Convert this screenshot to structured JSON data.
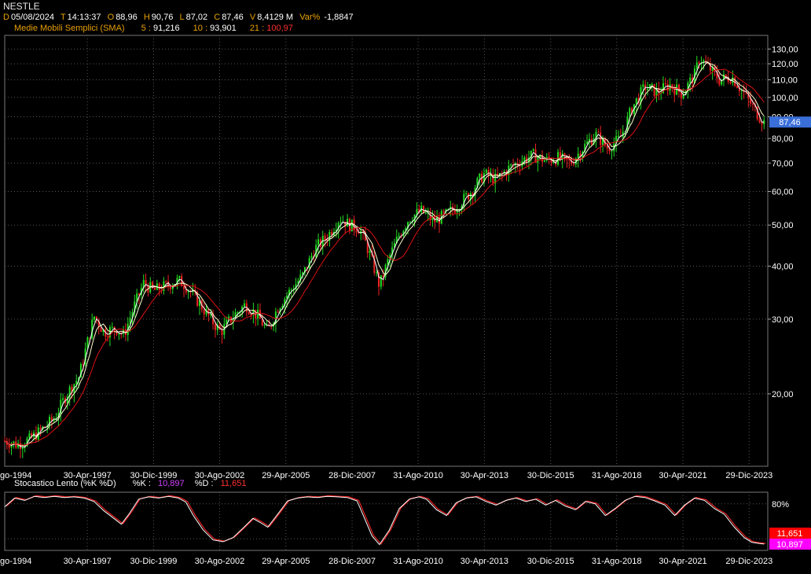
{
  "header": {
    "symbol": "NESTLE",
    "date_label": "D",
    "date": "05/08/2024",
    "time_label": "T",
    "time": "14:13:37",
    "open_label": "O",
    "open": "88,96",
    "high_label": "H",
    "high": "90,76",
    "low_label": "L",
    "low": "87,02",
    "close_label": "C",
    "close": "87,46",
    "volume_label": "V",
    "volume": "8,4129 M",
    "var_label": "Var%",
    "var": "-1,8847"
  },
  "sma": {
    "label": "Medie Mobili Semplici (SMA)",
    "p5_label": "5 :",
    "p5": "91,216",
    "p10_label": "10 :",
    "p10": "93,901",
    "p21_label": "21 :",
    "p21": "100,97"
  },
  "stochastic": {
    "label": "Stocastico Lento (%K %D)",
    "k_label": "%K :",
    "k": "10,897",
    "d_label": "%D :",
    "d": "11,651",
    "level_label": "80%"
  },
  "colors": {
    "background": "#000000",
    "up_candle": "#22dd22",
    "down_candle": "#ee2222",
    "sma5": "#ffffff",
    "sma10": "#ffffcc",
    "sma21": "#dd1111",
    "last_price_tag": "#3a6ed8",
    "d_tag": "#ff0000",
    "k_tag": "#ff00ff",
    "grid": "#555555"
  },
  "chart_data": [
    {
      "type": "candlestick",
      "title": "NESTLE",
      "scale": "log",
      "ylim": [
        13.5,
        140
      ],
      "y_ticks": [
        {
          "value": 130,
          "label": "130,00"
        },
        {
          "value": 120,
          "label": "120,00"
        },
        {
          "value": 110,
          "label": "110,00"
        },
        {
          "value": 100,
          "label": "100,00"
        },
        {
          "value": 90,
          "label": "90,00"
        },
        {
          "value": 80,
          "label": "80,00"
        },
        {
          "value": 70,
          "label": "70,00"
        },
        {
          "value": 60,
          "label": "60,00"
        },
        {
          "value": 50,
          "label": "50,00"
        },
        {
          "value": 40,
          "label": "40,00"
        },
        {
          "value": 30,
          "label": "30,00"
        },
        {
          "value": 20,
          "label": "20,00"
        }
      ],
      "x_ticks": [
        "go-1994",
        "30-Apr-1997",
        "30-Dic-1999",
        "30-Ago-2002",
        "29-Apr-2005",
        "28-Dic-2007",
        "31-Ago-2010",
        "30-Apr-2013",
        "30-Dic-2015",
        "31-Ago-2018",
        "30-Apr-2021",
        "29-Dic-2023"
      ],
      "last_price": {
        "value": 87.46,
        "label": "87,46"
      },
      "grid": true,
      "series_points": [
        [
          "1994.0",
          15.5
        ],
        [
          "1994.5",
          15.2
        ],
        [
          "1995.0",
          15.6
        ],
        [
          "1995.5",
          16.5
        ],
        [
          "1996.0",
          17.5
        ],
        [
          "1996.5",
          20.0
        ],
        [
          "1997.0",
          22.0
        ],
        [
          "1997.3",
          26.0
        ],
        [
          "1997.6",
          30.5
        ],
        [
          "1998.0",
          28.0
        ],
        [
          "1998.5",
          28.5
        ],
        [
          "1998.8",
          27.5
        ],
        [
          "1999.2",
          32.0
        ],
        [
          "1999.6",
          36.5
        ],
        [
          "2000.0",
          35.0
        ],
        [
          "2000.5",
          36.0
        ],
        [
          "2001.0",
          37.0
        ],
        [
          "2001.3",
          36.0
        ],
        [
          "2001.8",
          33.0
        ],
        [
          "2002.3",
          30.0
        ],
        [
          "2002.7",
          28.0
        ],
        [
          "2003.2",
          30.5
        ],
        [
          "2003.7",
          32.5
        ],
        [
          "2004.2",
          30.5
        ],
        [
          "2004.6",
          28.0
        ],
        [
          "2005.0",
          32.0
        ],
        [
          "2005.5",
          35.0
        ],
        [
          "2006.0",
          38.0
        ],
        [
          "2006.5",
          44.0
        ],
        [
          "2007.0",
          47.0
        ],
        [
          "2007.5",
          52.0
        ],
        [
          "2007.9",
          50.0
        ],
        [
          "2008.3",
          49.0
        ],
        [
          "2008.7",
          43.0
        ],
        [
          "2009.1",
          36.0
        ],
        [
          "2009.5",
          42.0
        ],
        [
          "2009.9",
          47.5
        ],
        [
          "2010.3",
          52.0
        ],
        [
          "2010.8",
          54.0
        ],
        [
          "2011.3",
          51.0
        ],
        [
          "2011.8",
          53.0
        ],
        [
          "2012.3",
          56.0
        ],
        [
          "2012.8",
          60.0
        ],
        [
          "2013.3",
          66.0
        ],
        [
          "2013.8",
          64.0
        ],
        [
          "2014.3",
          68.0
        ],
        [
          "2014.8",
          71.0
        ],
        [
          "2015.3",
          73.0
        ],
        [
          "2015.8",
          71.0
        ],
        [
          "2016.3",
          72.0
        ],
        [
          "2016.8",
          70.0
        ],
        [
          "2017.3",
          76.0
        ],
        [
          "2017.8",
          82.0
        ],
        [
          "2018.3",
          76.0
        ],
        [
          "2018.8",
          80.0
        ],
        [
          "2019.3",
          95.0
        ],
        [
          "2019.8",
          106.0
        ],
        [
          "2020.3",
          103.0
        ],
        [
          "2020.8",
          107.0
        ],
        [
          "2021.3",
          102.0
        ],
        [
          "2021.8",
          113.0
        ],
        [
          "2022.0",
          124.0
        ],
        [
          "2022.4",
          117.0
        ],
        [
          "2022.8",
          110.0
        ],
        [
          "2023.3",
          112.0
        ],
        [
          "2023.7",
          104.0
        ],
        [
          "2024.0",
          98.0
        ],
        [
          "2024.3",
          92.0
        ],
        [
          "2024.6",
          87.46
        ]
      ],
      "moving_averages": [
        {
          "name": "SMA 5",
          "last": 91.216
        },
        {
          "name": "SMA 10",
          "last": 93.901
        },
        {
          "name": "SMA 21",
          "last": 100.97
        }
      ]
    },
    {
      "type": "line",
      "title": "Stocastico Lento (%K %D)",
      "ylim": [
        0,
        100
      ],
      "level": 80,
      "series": [
        {
          "name": "%K",
          "last": 10.897
        },
        {
          "name": "%D",
          "last": 11.651
        }
      ],
      "points": [
        [
          "1994.0",
          75
        ],
        [
          "1994.4",
          90
        ],
        [
          "1994.8",
          86
        ],
        [
          "1995.2",
          93
        ],
        [
          "1995.6",
          91
        ],
        [
          "1996.0",
          93
        ],
        [
          "1996.4",
          91
        ],
        [
          "1996.8",
          92
        ],
        [
          "1997.2",
          90
        ],
        [
          "1997.6",
          84
        ],
        [
          "1998.0",
          68
        ],
        [
          "1998.4",
          55
        ],
        [
          "1998.7",
          45
        ],
        [
          "1999.0",
          62
        ],
        [
          "1999.4",
          88
        ],
        [
          "1999.8",
          92
        ],
        [
          "2000.2",
          90
        ],
        [
          "2000.6",
          93
        ],
        [
          "2001.0",
          90
        ],
        [
          "2001.3",
          83
        ],
        [
          "2001.6",
          60
        ],
        [
          "2002.0",
          35
        ],
        [
          "2002.4",
          18
        ],
        [
          "2002.8",
          15
        ],
        [
          "2003.2",
          22
        ],
        [
          "2003.6",
          38
        ],
        [
          "2004.0",
          55
        ],
        [
          "2004.3",
          48
        ],
        [
          "2004.6",
          40
        ],
        [
          "2005.0",
          62
        ],
        [
          "2005.4",
          85
        ],
        [
          "2005.8",
          90
        ],
        [
          "2006.2",
          92
        ],
        [
          "2006.6",
          91
        ],
        [
          "2007.0",
          93
        ],
        [
          "2007.4",
          92
        ],
        [
          "2007.8",
          91
        ],
        [
          "2008.2",
          85
        ],
        [
          "2008.5",
          55
        ],
        [
          "2008.8",
          25
        ],
        [
          "2009.1",
          10
        ],
        [
          "2009.5",
          35
        ],
        [
          "2009.9",
          72
        ],
        [
          "2010.3",
          88
        ],
        [
          "2010.7",
          92
        ],
        [
          "2011.0",
          88
        ],
        [
          "2011.4",
          70
        ],
        [
          "2011.8",
          60
        ],
        [
          "2012.2",
          82
        ],
        [
          "2012.6",
          90
        ],
        [
          "2013.0",
          92
        ],
        [
          "2013.4",
          84
        ],
        [
          "2013.8",
          78
        ],
        [
          "2014.2",
          86
        ],
        [
          "2014.6",
          90
        ],
        [
          "2015.0",
          84
        ],
        [
          "2015.4",
          88
        ],
        [
          "2015.8",
          78
        ],
        [
          "2016.2",
          86
        ],
        [
          "2016.6",
          76
        ],
        [
          "2017.0",
          70
        ],
        [
          "2017.4",
          84
        ],
        [
          "2017.8",
          80
        ],
        [
          "2018.2",
          60
        ],
        [
          "2018.6",
          72
        ],
        [
          "2019.0",
          86
        ],
        [
          "2019.4",
          93
        ],
        [
          "2019.8",
          91
        ],
        [
          "2020.2",
          85
        ],
        [
          "2020.6",
          78
        ],
        [
          "2021.0",
          60
        ],
        [
          "2021.4",
          78
        ],
        [
          "2021.8",
          90
        ],
        [
          "2022.2",
          86
        ],
        [
          "2022.6",
          72
        ],
        [
          "2023.0",
          62
        ],
        [
          "2023.4",
          40
        ],
        [
          "2023.8",
          22
        ],
        [
          "2024.1",
          14
        ],
        [
          "2024.4",
          12
        ],
        [
          "2024.6",
          11
        ]
      ]
    }
  ]
}
